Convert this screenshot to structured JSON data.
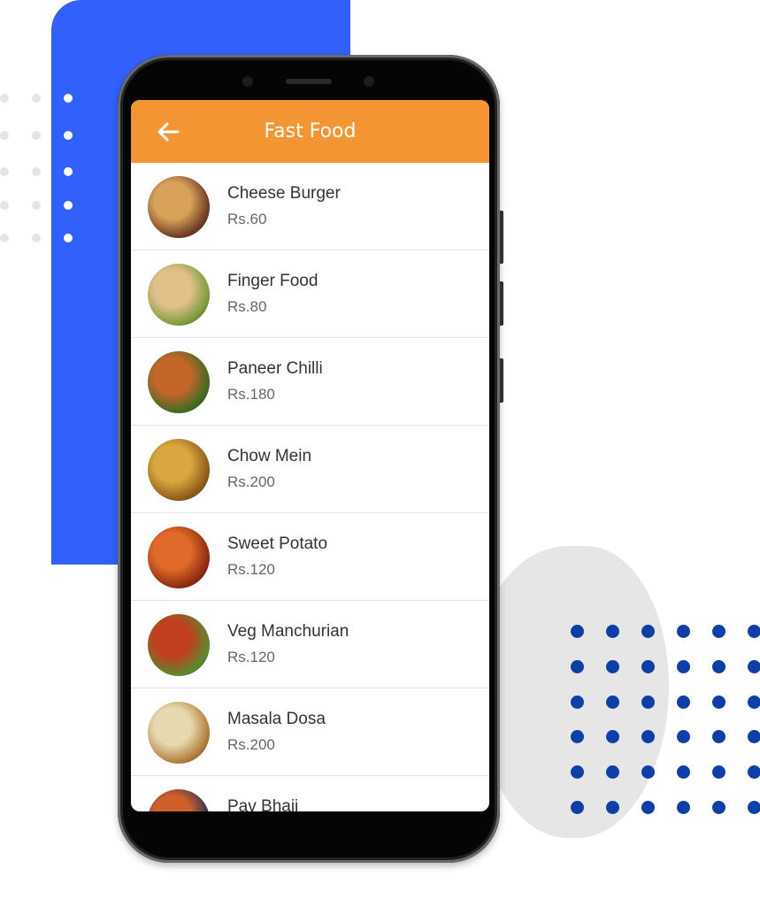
{
  "colors": {
    "accent": "#f39533",
    "decor_blue": "#3160fb",
    "dots_blue": "#0d3fa6"
  },
  "header": {
    "title": "Fast Food",
    "back_icon": "arrow-left-icon"
  },
  "items": [
    {
      "name": "Cheese Burger",
      "price": "Rs.60",
      "c1": "#d9a25a",
      "c2": "#6b3a22"
    },
    {
      "name": "Finger Food",
      "price": "Rs.80",
      "c1": "#e2c08a",
      "c2": "#7a9a3a"
    },
    {
      "name": "Paneer Chilli",
      "price": "Rs.180",
      "c1": "#c4652a",
      "c2": "#3d6b22"
    },
    {
      "name": "Chow Mein",
      "price": "Rs.200",
      "c1": "#d9a640",
      "c2": "#8a5a1a"
    },
    {
      "name": "Sweet Potato",
      "price": "Rs.120",
      "c1": "#e06a2a",
      "c2": "#8a2a10"
    },
    {
      "name": "Veg Manchurian",
      "price": "Rs.120",
      "c1": "#c0401e",
      "c2": "#5a8a30"
    },
    {
      "name": "Masala Dosa",
      "price": "Rs.200",
      "c1": "#e8d8b0",
      "c2": "#b07a3a"
    },
    {
      "name": "Pav Bhaji",
      "price": "",
      "c1": "#d0602a",
      "c2": "#2a3550"
    }
  ]
}
